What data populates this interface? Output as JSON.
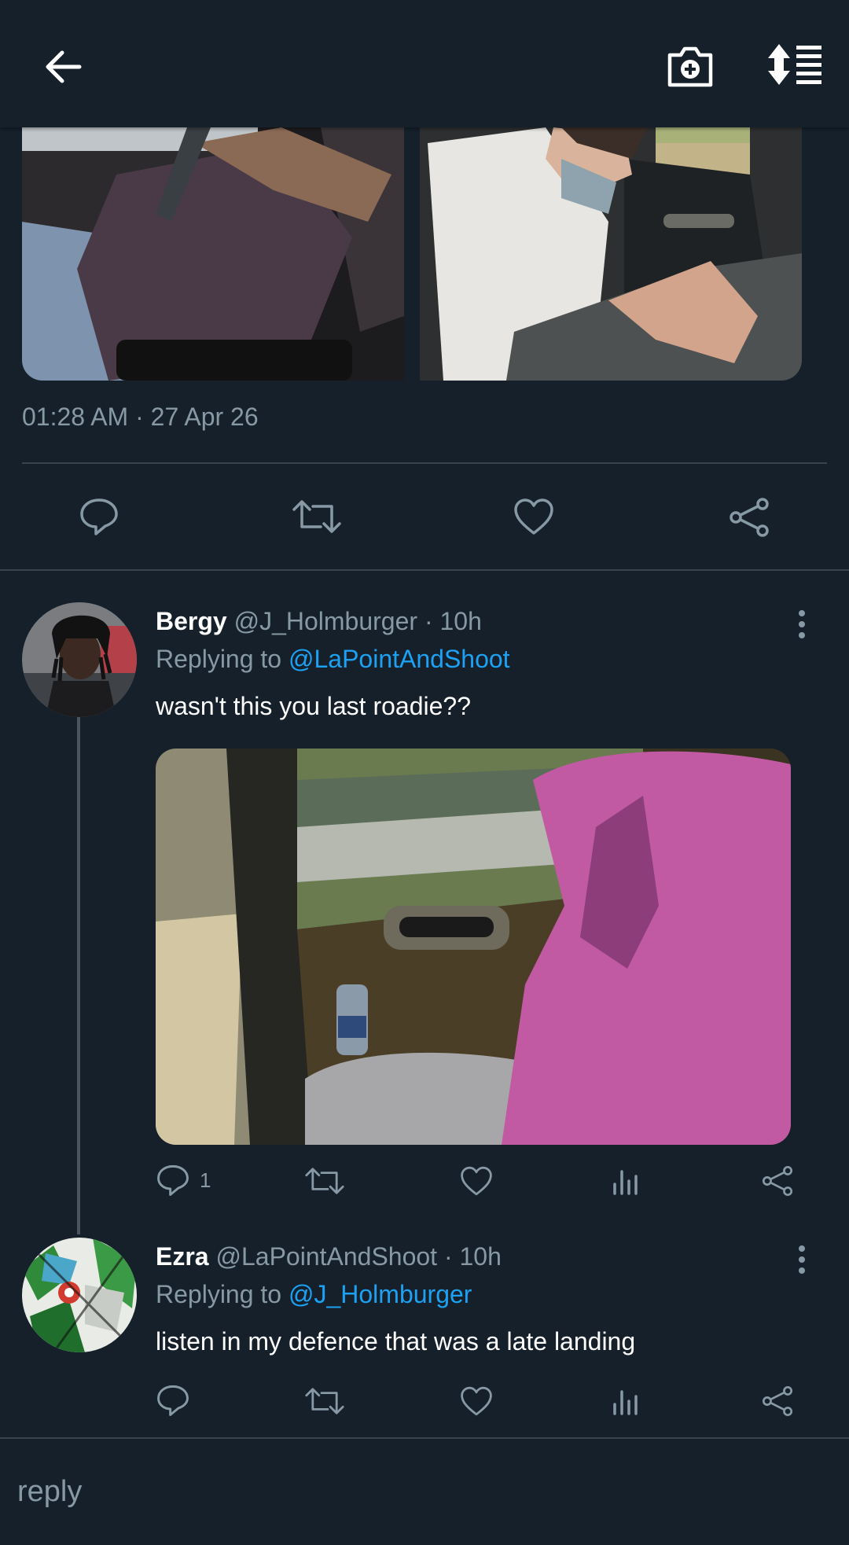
{
  "header": {
    "back_icon": "arrow-left-icon",
    "camera_icon": "camera-plus-icon",
    "sort_icon": "sort-list-icon"
  },
  "main_tweet": {
    "timestamp": "01:28 AM · 27 Apr 26",
    "media": [
      {
        "description_icon": "photo"
      },
      {
        "description_icon": "photo"
      }
    ]
  },
  "replies": [
    {
      "name": "Bergy",
      "handle": "@J_Holmburger",
      "time": "10h",
      "replying_prefix": "Replying to",
      "replying_to": "@LaPointAndShoot",
      "text": "wasn't this you last roadie??",
      "reply_count": "1"
    },
    {
      "name": "Ezra",
      "handle": "@LaPointAndShoot",
      "time": "10h",
      "replying_prefix": "Replying to",
      "replying_to": "@J_Holmburger",
      "text": "listen in my defence that was a late landing"
    }
  ],
  "composer": {
    "placeholder": "reply"
  },
  "colors": {
    "background": "#15202b",
    "muted": "#8899a6",
    "link": "#1da1f2",
    "divider": "#38444d"
  }
}
